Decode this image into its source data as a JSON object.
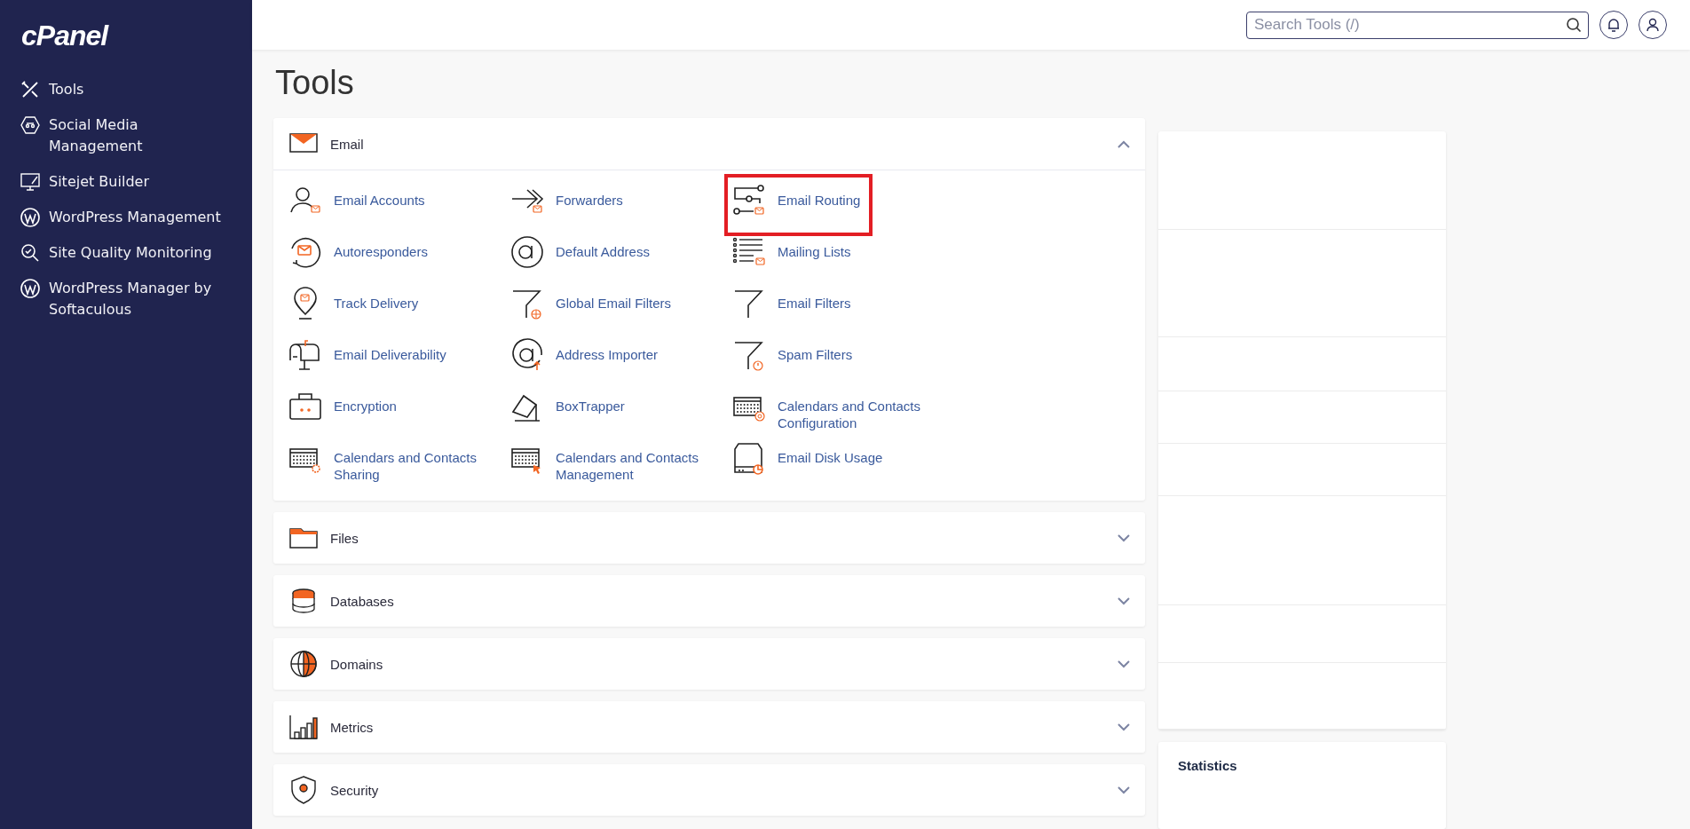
{
  "sidebar": {
    "logo": "cPanel",
    "items": [
      {
        "label": "Tools"
      },
      {
        "label": "Social Media Management"
      },
      {
        "label": "Sitejet Builder"
      },
      {
        "label": "WordPress Management"
      },
      {
        "label": "Site Quality Monitoring"
      },
      {
        "label": "WordPress Manager by Softaculous"
      }
    ]
  },
  "topbar": {
    "search": {
      "placeholder": "Search Tools (/)"
    }
  },
  "page": {
    "title": "Tools"
  },
  "sections": [
    {
      "title": "Email",
      "expanded": true,
      "items": [
        {
          "label": "Email Accounts",
          "highlighted": false
        },
        {
          "label": "Forwarders",
          "highlighted": false
        },
        {
          "label": "Email Routing",
          "highlighted": true
        },
        {
          "label": "Autoresponders",
          "highlighted": false
        },
        {
          "label": "Default Address",
          "highlighted": false
        },
        {
          "label": "Mailing Lists",
          "highlighted": false
        },
        {
          "label": "Track Delivery",
          "highlighted": false
        },
        {
          "label": "Global Email Filters",
          "highlighted": false
        },
        {
          "label": "Email Filters",
          "highlighted": false
        },
        {
          "label": "Email Deliverability",
          "highlighted": false
        },
        {
          "label": "Address Importer",
          "highlighted": false
        },
        {
          "label": "Spam Filters",
          "highlighted": false
        },
        {
          "label": "Encryption",
          "highlighted": false
        },
        {
          "label": "BoxTrapper",
          "highlighted": false
        },
        {
          "label": "Calendars and Contacts Configuration",
          "highlighted": false
        },
        {
          "label": "Calendars and Contacts Sharing",
          "highlighted": false
        },
        {
          "label": "Calendars and Contacts Management",
          "highlighted": false
        },
        {
          "label": "Email Disk Usage",
          "highlighted": false
        }
      ]
    },
    {
      "title": "Files",
      "expanded": false
    },
    {
      "title": "Databases",
      "expanded": false
    },
    {
      "title": "Domains",
      "expanded": false
    },
    {
      "title": "Metrics",
      "expanded": false
    },
    {
      "title": "Security",
      "expanded": false
    }
  ],
  "side_panel": {
    "statistics": {
      "title": "Statistics"
    }
  }
}
